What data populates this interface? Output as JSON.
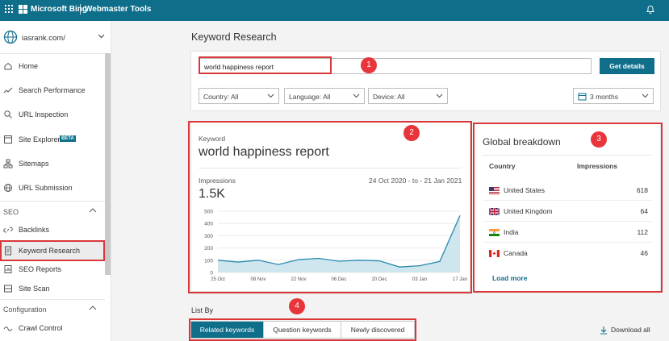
{
  "topbar": {
    "brand": "Microsoft Bing",
    "product": "Webmaster Tools",
    "icons": [
      "app-launcher-icon",
      "microsoft-logo-icon",
      "bell-icon"
    ]
  },
  "sidebar": {
    "site_name": "iasrank.com/",
    "items": [
      {
        "label": "Home",
        "icon": "home-icon"
      },
      {
        "label": "Search Performance",
        "icon": "trend-icon"
      },
      {
        "label": "URL Inspection",
        "icon": "search-icon"
      },
      {
        "label": "Site Explorer",
        "icon": "site-explorer-icon",
        "badge": "BETA"
      },
      {
        "label": "Sitemaps",
        "icon": "sitemap-icon"
      },
      {
        "label": "URL Submission",
        "icon": "globe-icon"
      }
    ],
    "groups": [
      {
        "label": "SEO",
        "items": [
          {
            "label": "Backlinks",
            "icon": "link-icon"
          },
          {
            "label": "Keyword Research",
            "icon": "document-icon",
            "selected": true
          },
          {
            "label": "SEO Reports",
            "icon": "report-icon"
          },
          {
            "label": "Site Scan",
            "icon": "scan-icon"
          }
        ]
      },
      {
        "label": "Configuration",
        "items": [
          {
            "label": "Crawl Control",
            "icon": "crawl-icon"
          }
        ]
      }
    ]
  },
  "page": {
    "title": "Keyword Research"
  },
  "search": {
    "value": "world happiness report",
    "button": "Get details"
  },
  "filters": {
    "country": "Country: All",
    "language": "Language: All",
    "device": "Device: All",
    "date_range": "3 months"
  },
  "keyword": {
    "label": "Keyword",
    "title": "world happiness report",
    "impressions_label": "Impressions",
    "date_range": "24 Oct 2020 - to - 21 Jan 2021",
    "impressions_total": "1.5K",
    "chart_color": "#2a8ab0",
    "fill_color": "#cfe6ef"
  },
  "chart_data": {
    "type": "area",
    "x": [
      "25 Oct",
      "01 Nov",
      "08 Nov",
      "15 Nov",
      "22 Nov",
      "29 Nov",
      "06 Dec",
      "13 Dec",
      "20 Dec",
      "27 Dec",
      "03 Jan",
      "10 Jan",
      "17 Jan"
    ],
    "y": [
      100,
      85,
      100,
      65,
      105,
      115,
      92,
      100,
      95,
      45,
      55,
      90,
      465
    ],
    "x_tick_labels": [
      "25 Oct",
      "08 Nov",
      "22 Nov",
      "06 Dec",
      "20 Dec",
      "03 Jan",
      "17 Jan"
    ],
    "y_ticks": [
      0,
      100,
      200,
      300,
      400,
      500
    ],
    "ylim": [
      0,
      500
    ],
    "grid": true
  },
  "global": {
    "title": "Global breakdown",
    "col_country": "Country",
    "col_impressions": "Impressions",
    "rows": [
      {
        "country": "United States",
        "value": "618",
        "flag": "us-flag-icon"
      },
      {
        "country": "United Kingdom",
        "value": "64",
        "flag": "uk-flag-icon"
      },
      {
        "country": "India",
        "value": "112",
        "flag": "india-flag-icon"
      },
      {
        "country": "Canada",
        "value": "46",
        "flag": "canada-flag-icon"
      }
    ],
    "load_more": "Load more"
  },
  "list_by": {
    "label": "List By",
    "tabs": [
      "Related keywords",
      "Question keywords",
      "Newly discovered"
    ],
    "active": 0,
    "download": "Download all"
  },
  "annotations": {
    "badges": [
      "1",
      "2",
      "3",
      "4"
    ],
    "color": "#d9383a"
  }
}
